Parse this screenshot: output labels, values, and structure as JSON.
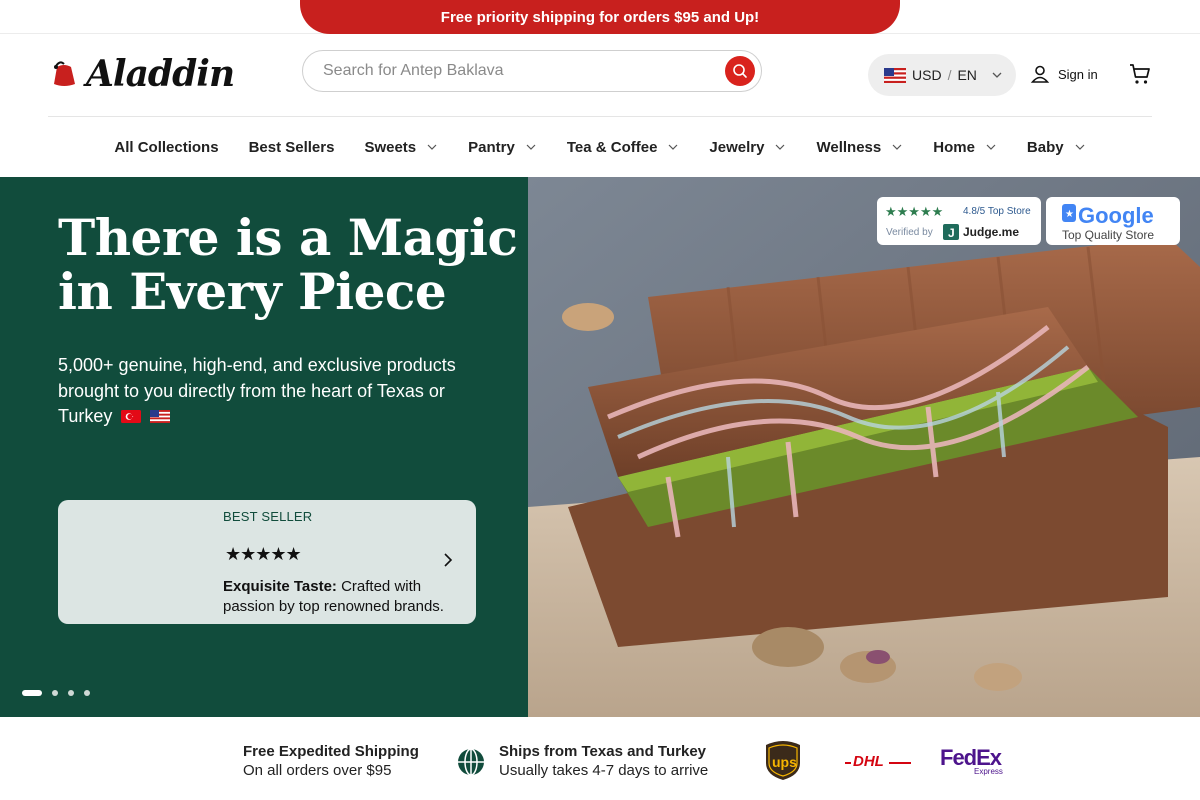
{
  "promo": {
    "text": "Free priority shipping for orders $95 and Up!"
  },
  "header": {
    "logo_text": "Aladdin",
    "search_placeholder": "Search for Antep Baklava",
    "currency_label": "USD",
    "currency_sep": "/",
    "language_label": "EN",
    "signin_label": "Sign in"
  },
  "nav": {
    "items": [
      {
        "label": "All Collections"
      },
      {
        "label": "Best Sellers"
      },
      {
        "label": "Sweets"
      },
      {
        "label": "Pantry"
      },
      {
        "label": "Tea & Coffee"
      },
      {
        "label": "Jewelry"
      },
      {
        "label": "Wellness"
      },
      {
        "label": "Home"
      },
      {
        "label": "Baby"
      }
    ]
  },
  "hero": {
    "title": "There is a Magic in Every Piece",
    "subtitle": "5,000+ genuine, high-end, and exclusive products brought to you directly from the heart of Texas or Turkey",
    "card": {
      "badge": "BEST SELLER",
      "stars": "★★★★★",
      "text_bold": "Exquisite Taste:",
      "text_rest": " Crafted with passion by top renowned brands."
    },
    "badges": {
      "judge_rating": "4.8/5 Top Store",
      "judge_verified": "Verified by",
      "judge_brand": "Judge.me",
      "google_brand": "Google",
      "google_sub": "Top Quality Store"
    }
  },
  "features": {
    "shipping_title": "Free Expedited Shipping",
    "shipping_sub": "On all orders over $95",
    "ships_title": "Ships from Texas and Turkey",
    "ships_sub": "Usually takes 4-7 days to arrive",
    "carriers": [
      "ups",
      "DHL",
      "FedEx",
      "Express"
    ]
  },
  "colors": {
    "promo_red": "#c8201e",
    "hero_green": "#114c3c",
    "search_red": "#d9231d"
  }
}
